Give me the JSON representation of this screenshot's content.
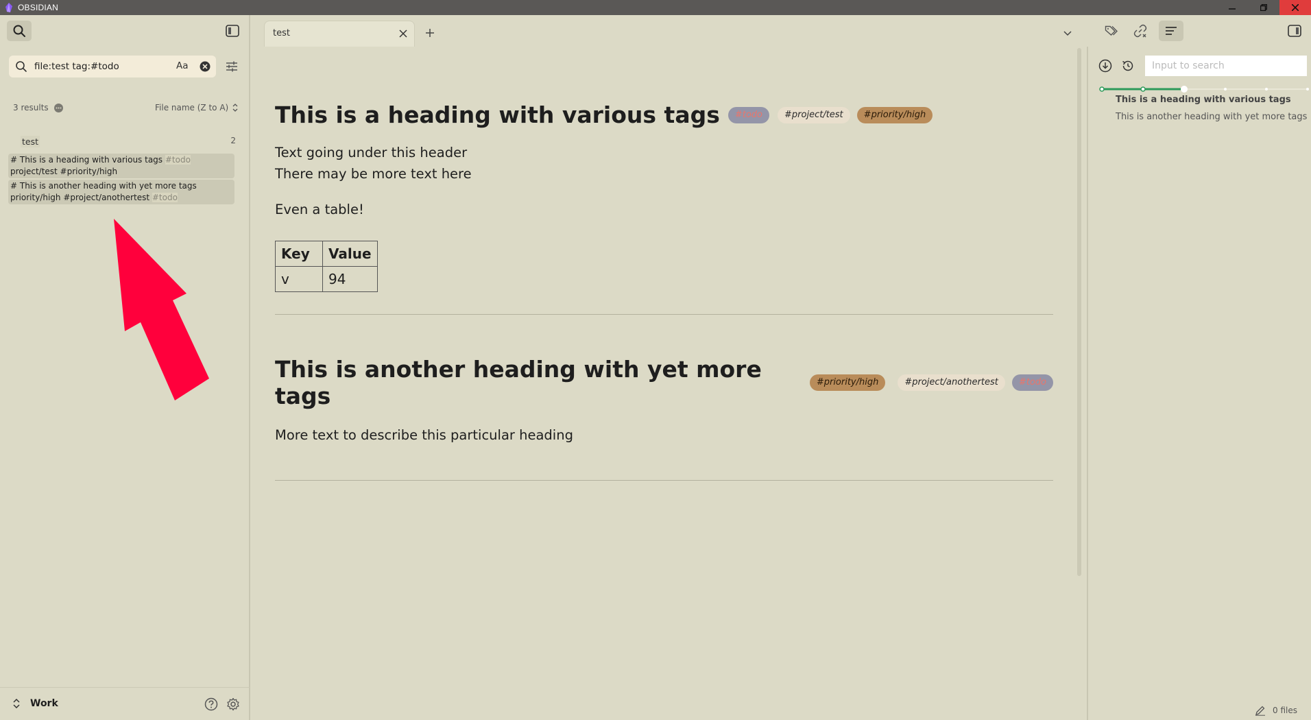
{
  "app": {
    "title": "OBSIDIAN"
  },
  "colors": {
    "accent": "#2d9a5a",
    "tag_todo_bg": "#9495a8",
    "tag_todo_fg": "#e8766c",
    "tag_project_bg": "#e9dfcd",
    "tag_priority_bg": "#b98c5a",
    "close_red": "#e03c3c"
  },
  "left_sidebar": {
    "search": {
      "value": "file:test tag:#todo",
      "match_case_label": "Aa"
    },
    "results_count": "3 results",
    "sort_order": "File name (Z to A)",
    "file_result": {
      "name": "test",
      "count": "2"
    },
    "matches": [
      {
        "line1_text": "# This is a heading with various tags ",
        "line1_tag": "#todo",
        "line2_text": "project/test #priority/high"
      },
      {
        "line1_text": "# This is another heading with yet more tags",
        "line2_text": "priority/high  #project/anothertest ",
        "line2_tag": "#todo"
      }
    ],
    "vault_name": "Work"
  },
  "tabs": [
    {
      "label": "test"
    }
  ],
  "document": {
    "heading1": "This is a heading with various tags",
    "heading1_tags": [
      "#todo",
      "#project/test",
      "#priority/high"
    ],
    "para1_line1": "Text going under this header",
    "para1_line2": "There may be more text here",
    "para2": "Even a table!",
    "table": {
      "headers": [
        "Key",
        "Value"
      ],
      "rows": [
        [
          "v",
          "94"
        ]
      ]
    },
    "heading2": "This is another heading with yet more tags",
    "heading2_tags": [
      "#priority/high",
      "#project/anothertest",
      "#todo"
    ],
    "para3": "More text to describe this particular heading"
  },
  "right_sidebar": {
    "search_placeholder": "Input to search",
    "outline": [
      "This is a heading with various tags",
      "This is another heading with yet more tags"
    ],
    "status": "0 files"
  },
  "icons": [
    "search-icon",
    "sidebar-toggle-icon",
    "clear-icon",
    "filter-icon",
    "more-icon",
    "sort-icon",
    "vault-switch-icon",
    "help-icon",
    "gear-icon",
    "close-icon",
    "plus-icon",
    "chevron-down-icon",
    "tags-icon",
    "links-icon",
    "outline-icon",
    "download-icon",
    "history-icon",
    "pencil-icon",
    "minimize-icon",
    "restore-icon"
  ]
}
